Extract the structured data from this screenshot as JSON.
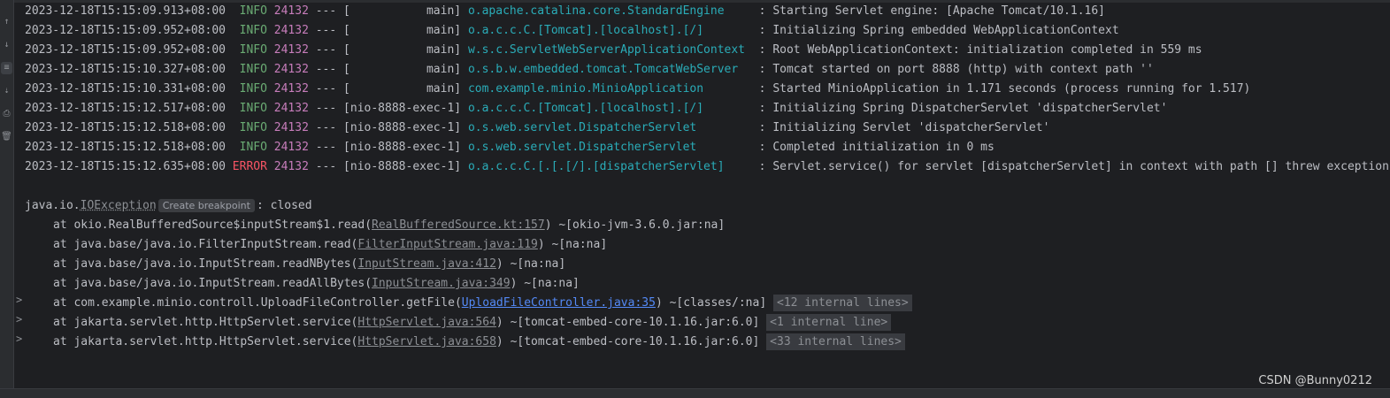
{
  "gutter_icons": [
    "arrow-up-icon",
    "arrow-down-icon",
    "soft-wrap-icon",
    "scroll-to-end-icon",
    "print-icon",
    "trash-icon"
  ],
  "logs": [
    {
      "ts": "2023-12-18T15:15:09.913+08:00",
      "level": "INFO",
      "pid": "24132",
      "sep": " --- ",
      "thread": "[           main]",
      "logger": "o.apache.catalina.core.StandardEngine    ",
      "msg": ": Starting Servlet engine: [Apache Tomcat/10.1.16]"
    },
    {
      "ts": "2023-12-18T15:15:09.952+08:00",
      "level": "INFO",
      "pid": "24132",
      "sep": " --- ",
      "thread": "[           main]",
      "logger": "o.a.c.c.C.[Tomcat].[localhost].[/]       ",
      "msg": ": Initializing Spring embedded WebApplicationContext"
    },
    {
      "ts": "2023-12-18T15:15:09.952+08:00",
      "level": "INFO",
      "pid": "24132",
      "sep": " --- ",
      "thread": "[           main]",
      "logger": "w.s.c.ServletWebServerApplicationContext ",
      "msg": ": Root WebApplicationContext: initialization completed in 559 ms"
    },
    {
      "ts": "2023-12-18T15:15:10.327+08:00",
      "level": "INFO",
      "pid": "24132",
      "sep": " --- ",
      "thread": "[           main]",
      "logger": "o.s.b.w.embedded.tomcat.TomcatWebServer  ",
      "msg": ": Tomcat started on port 8888 (http) with context path ''"
    },
    {
      "ts": "2023-12-18T15:15:10.331+08:00",
      "level": "INFO",
      "pid": "24132",
      "sep": " --- ",
      "thread": "[           main]",
      "logger": "com.example.minio.MinioApplication       ",
      "msg": ": Started MinioApplication in 1.171 seconds (process running for 1.517)"
    },
    {
      "ts": "2023-12-18T15:15:12.517+08:00",
      "level": "INFO",
      "pid": "24132",
      "sep": " --- ",
      "thread": "[nio-8888-exec-1]",
      "logger": "o.a.c.c.C.[Tomcat].[localhost].[/]       ",
      "msg": ": Initializing Spring DispatcherServlet 'dispatcherServlet'"
    },
    {
      "ts": "2023-12-18T15:15:12.518+08:00",
      "level": "INFO",
      "pid": "24132",
      "sep": " --- ",
      "thread": "[nio-8888-exec-1]",
      "logger": "o.s.web.servlet.DispatcherServlet        ",
      "msg": ": Initializing Servlet 'dispatcherServlet'"
    },
    {
      "ts": "2023-12-18T15:15:12.518+08:00",
      "level": "INFO",
      "pid": "24132",
      "sep": " --- ",
      "thread": "[nio-8888-exec-1]",
      "logger": "o.s.web.servlet.DispatcherServlet        ",
      "msg": ": Completed initialization in 0 ms"
    },
    {
      "ts": "2023-12-18T15:15:12.635+08:00",
      "level": "ERROR",
      "pid": "24132",
      "sep": " --- ",
      "thread": "[nio-8888-exec-1]",
      "logger": "o.a.c.c.C.[.[.[/].[dispatcherServlet]    ",
      "msg": ": Servlet.service() for servlet [dispatcherServlet] in context with path [] threw exception"
    }
  ],
  "exception": {
    "prefix": "java.io.",
    "class": "IOException",
    "breakpoint_label": "Create breakpoint",
    "suffix": ": closed"
  },
  "trace": [
    {
      "pre": "at okio.RealBufferedSource$inputStream$1.read(",
      "link": "RealBufferedSource.kt:157",
      "post": ") ~[okio-jvm-3.6.0.jar:na]",
      "internal": "",
      "chevron": false,
      "blue": false
    },
    {
      "pre": "at java.base/java.io.FilterInputStream.read(",
      "link": "FilterInputStream.java:119",
      "post": ") ~[na:na]",
      "internal": "",
      "chevron": false,
      "blue": false
    },
    {
      "pre": "at java.base/java.io.InputStream.readNBytes(",
      "link": "InputStream.java:412",
      "post": ") ~[na:na]",
      "internal": "",
      "chevron": false,
      "blue": false
    },
    {
      "pre": "at java.base/java.io.InputStream.readAllBytes(",
      "link": "InputStream.java:349",
      "post": ") ~[na:na]",
      "internal": "",
      "chevron": false,
      "blue": false
    },
    {
      "pre": "at com.example.minio.controll.UploadFileController.getFile(",
      "link": "UploadFileController.java:35",
      "post": ") ~[classes/:na]",
      "internal": "<12 internal lines>",
      "chevron": true,
      "blue": true
    },
    {
      "pre": "at jakarta.servlet.http.HttpServlet.service(",
      "link": "HttpServlet.java:564",
      "post": ") ~[tomcat-embed-core-10.1.16.jar:6.0]",
      "internal": "<1 internal line>",
      "chevron": true,
      "blue": false
    },
    {
      "pre": "at jakarta.servlet.http.HttpServlet.service(",
      "link": "HttpServlet.java:658",
      "post": ") ~[tomcat-embed-core-10.1.16.jar:6.0]",
      "internal": "<33 internal lines>",
      "chevron": true,
      "blue": false
    }
  ],
  "chevron_glyph": ">",
  "watermark": "CSDN @Bunny0212"
}
